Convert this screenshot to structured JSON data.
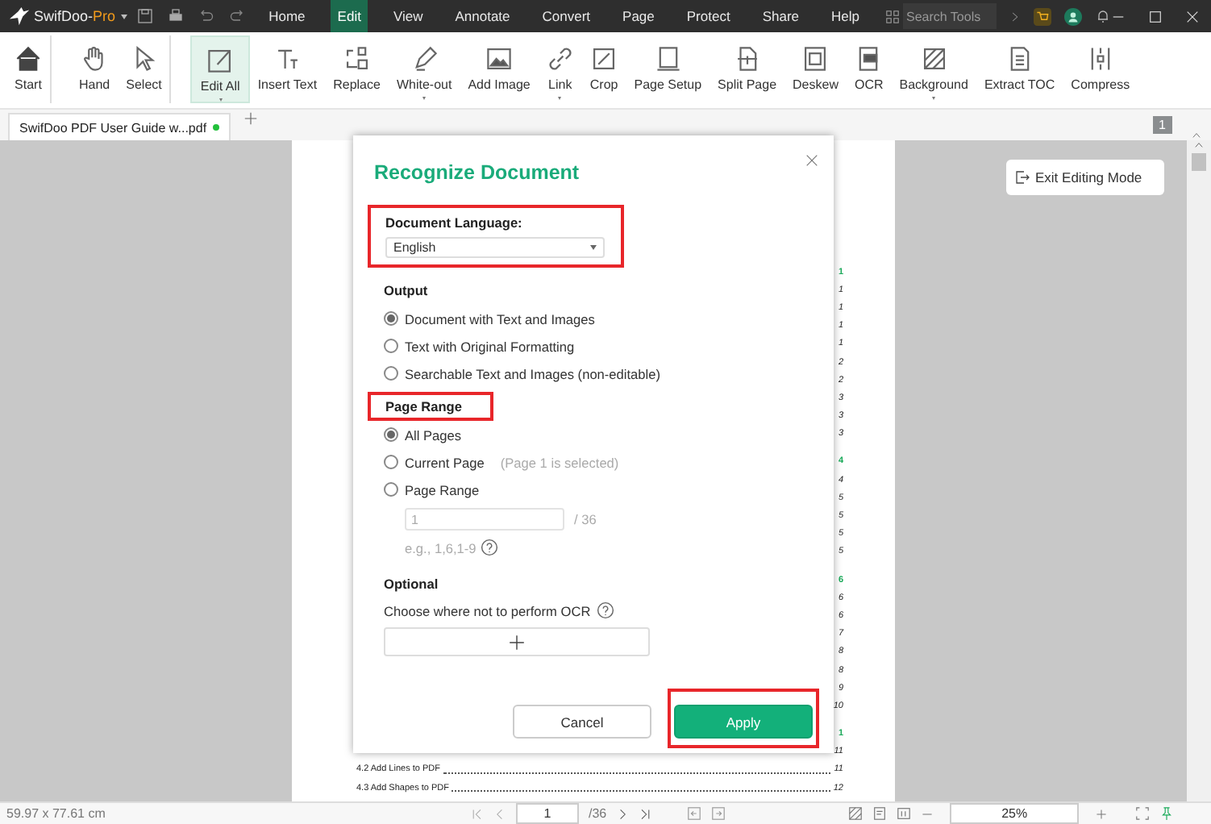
{
  "app": {
    "brand": "SwifDoo-",
    "edition": "Pro"
  },
  "menu": [
    {
      "label": "Home",
      "selected": false
    },
    {
      "label": "Edit",
      "selected": true
    },
    {
      "label": "View",
      "selected": false
    },
    {
      "label": "Annotate",
      "selected": false
    },
    {
      "label": "Convert",
      "selected": false
    },
    {
      "label": "Page",
      "selected": false
    },
    {
      "label": "Protect",
      "selected": false
    },
    {
      "label": "Share",
      "selected": false
    },
    {
      "label": "Help",
      "selected": false
    }
  ],
  "search": {
    "placeholder": "Search Tools"
  },
  "ribbon": [
    {
      "label": "Start",
      "selected": false,
      "has_menu": false,
      "group_end": true
    },
    {
      "label": "Hand",
      "selected": false,
      "has_menu": false,
      "group_end": false
    },
    {
      "label": "Select",
      "selected": false,
      "has_menu": false,
      "group_end": true
    },
    {
      "label": "Edit All",
      "selected": true,
      "has_menu": true,
      "group_end": false
    },
    {
      "label": "Insert Text",
      "selected": false,
      "has_menu": false,
      "group_end": false
    },
    {
      "label": "Replace",
      "selected": false,
      "has_menu": false,
      "group_end": false
    },
    {
      "label": "White-out",
      "selected": false,
      "has_menu": true,
      "group_end": false
    },
    {
      "label": "Add Image",
      "selected": false,
      "has_menu": false,
      "group_end": false
    },
    {
      "label": "Link",
      "selected": false,
      "has_menu": true,
      "group_end": false
    },
    {
      "label": "Crop",
      "selected": false,
      "has_menu": false,
      "group_end": false
    },
    {
      "label": "Page Setup",
      "selected": false,
      "has_menu": false,
      "group_end": false
    },
    {
      "label": "Split Page",
      "selected": false,
      "has_menu": false,
      "group_end": false
    },
    {
      "label": "Deskew",
      "selected": false,
      "has_menu": false,
      "group_end": false
    },
    {
      "label": "OCR",
      "selected": false,
      "has_menu": false,
      "group_end": false
    },
    {
      "label": "Background",
      "selected": false,
      "has_menu": true,
      "group_end": false
    },
    {
      "label": "Extract TOC",
      "selected": false,
      "has_menu": false,
      "group_end": false
    },
    {
      "label": "Compress",
      "selected": false,
      "has_menu": false,
      "group_end": false
    }
  ],
  "doc_tabs": [
    {
      "label": "SwifDoo PDF User Guide w...pdf",
      "selected": true,
      "unsaved": true
    }
  ],
  "page_badge": "1",
  "exit_button": "Exit Editing Mode",
  "toc": [
    {
      "kind": "heading",
      "page": "1"
    },
    {
      "kind": "entry",
      "page": "1"
    },
    {
      "kind": "entry",
      "page": "1"
    },
    {
      "kind": "entry",
      "page": "1"
    },
    {
      "kind": "entry",
      "page": "1"
    },
    {
      "kind": "entry",
      "page": "2"
    },
    {
      "kind": "entry",
      "page": "2"
    },
    {
      "kind": "entry",
      "page": "3"
    },
    {
      "kind": "entry",
      "page": "3"
    },
    {
      "kind": "entry",
      "page": "3"
    },
    {
      "kind": "heading",
      "page": "4"
    },
    {
      "kind": "entry",
      "page": "4"
    },
    {
      "kind": "entry",
      "page": "5"
    },
    {
      "kind": "entry",
      "page": "5"
    },
    {
      "kind": "entry",
      "page": "5"
    },
    {
      "kind": "entry",
      "page": "5"
    },
    {
      "kind": "heading",
      "page": "6"
    },
    {
      "kind": "entry",
      "page": "6"
    },
    {
      "kind": "entry",
      "page": "6"
    },
    {
      "kind": "entry",
      "page": "7"
    },
    {
      "kind": "entry",
      "page": "8"
    },
    {
      "kind": "entry",
      "page": "8"
    },
    {
      "kind": "entry",
      "page": "9"
    },
    {
      "kind": "entry",
      "page": "10"
    },
    {
      "kind": "heading",
      "page": "1"
    },
    {
      "kind": "entry",
      "page": "11"
    },
    {
      "kind": "entry",
      "title": "4.2 Add Lines to PDF",
      "page": "11"
    },
    {
      "kind": "entry",
      "title": "4.3 Add Shapes to PDF",
      "page": "12"
    }
  ],
  "dialog": {
    "title": "Recognize Document",
    "language": {
      "label": "Document Language:",
      "value": "English",
      "highlighted": true
    },
    "output": {
      "heading": "Output",
      "options": [
        {
          "label": "Document with Text and Images",
          "selected": true
        },
        {
          "label": "Text with Original Formatting",
          "selected": false
        },
        {
          "label": "Searchable Text and Images (non-editable)",
          "selected": false
        }
      ]
    },
    "page_range": {
      "heading": "Page Range",
      "highlighted": true,
      "options": [
        {
          "label": "All Pages",
          "selected": true
        },
        {
          "label": "Current Page",
          "note": "(Page 1 is selected)",
          "selected": false
        },
        {
          "label": "Page Range",
          "selected": false
        }
      ],
      "input": {
        "value": "1",
        "total": "/ 36",
        "disabled": true
      },
      "hint": "e.g., 1,6,1-9"
    },
    "optional": {
      "heading": "Optional",
      "text": "Choose where not to perform OCR"
    },
    "buttons": [
      {
        "label": "Cancel",
        "kind": "secondary",
        "highlighted": false
      },
      {
        "label": "Apply",
        "kind": "primary",
        "highlighted": true
      }
    ]
  },
  "status": {
    "size": "59.97 x 77.61 cm",
    "page": "1",
    "total": "/36",
    "zoom": "25%"
  }
}
